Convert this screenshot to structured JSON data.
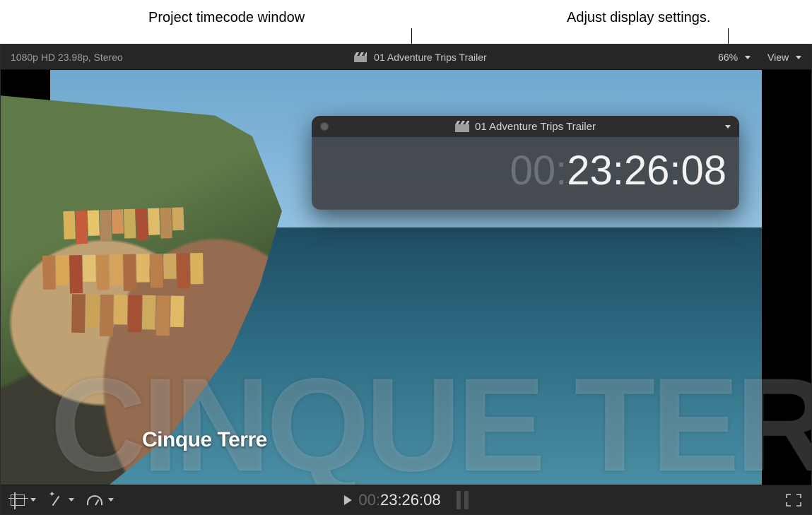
{
  "annotations": {
    "left": "Project timecode window",
    "right": "Adjust display settings."
  },
  "viewer": {
    "format_spec": "1080p HD 23.98p, Stereo",
    "project_title": "01 Adventure Trips Trailer",
    "zoom_label": "66%",
    "view_menu_label": "View"
  },
  "timecode_window": {
    "title": "01 Adventure Trips Trailer",
    "tc_prefix": "00:",
    "tc_main": "23:26:08"
  },
  "overlay": {
    "bg_title": "CINQUE TERRE",
    "subtitle": "Cinque Terre"
  },
  "transport": {
    "tc_prefix": "00:",
    "tc_main": "23:26:08"
  },
  "icons": {
    "clapper": "clapperboard-icon",
    "zoom_chevron": "chevron-down-icon",
    "view_chevron": "chevron-down-icon",
    "close_dot": "window-close-icon",
    "settings_chevron": "chevron-down-icon",
    "play": "play-icon",
    "crop": "crop-icon",
    "wand": "wand-icon",
    "gauge": "retime-gauge-icon",
    "fullscreen": "fullscreen-icon"
  }
}
